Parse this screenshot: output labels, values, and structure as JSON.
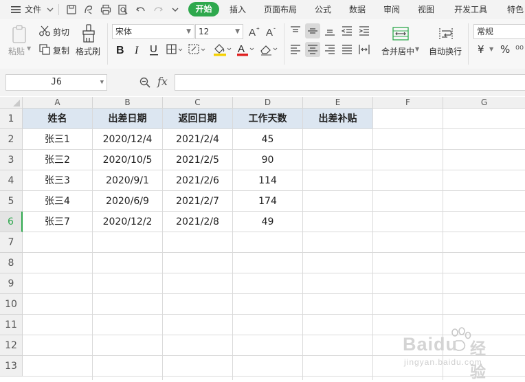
{
  "menu": {
    "file_label": "文件",
    "tabs": [
      {
        "label": "开始",
        "active": true
      },
      {
        "label": "插入"
      },
      {
        "label": "页面布局"
      },
      {
        "label": "公式"
      },
      {
        "label": "数据"
      },
      {
        "label": "审阅"
      },
      {
        "label": "视图"
      },
      {
        "label": "开发工具"
      },
      {
        "label": "特色"
      }
    ]
  },
  "ribbon": {
    "paste": "粘贴",
    "cut": "剪切",
    "copy": "复制",
    "format_painter": "格式刷",
    "font_name": "宋体",
    "font_size": "12",
    "merge_center": "合并居中",
    "wrap_text": "自动换行",
    "number_format": "常规",
    "currency_symbol": "¥",
    "percent_symbol": "%"
  },
  "formula_bar": {
    "name_box": "J6",
    "fx": "fx",
    "formula": ""
  },
  "sheet": {
    "columns": [
      "A",
      "B",
      "C",
      "D",
      "E",
      "F",
      "G"
    ],
    "rows": [
      "1",
      "2",
      "3",
      "4",
      "5",
      "6",
      "7",
      "8",
      "9",
      "10",
      "11",
      "12",
      "13"
    ],
    "active_row": "6",
    "header": [
      "姓名",
      "出差日期",
      "返回日期",
      "工作天数",
      "出差补贴"
    ],
    "data": [
      [
        "张三1",
        "2020/12/4",
        "2021/2/4",
        "45",
        ""
      ],
      [
        "张三2",
        "2020/10/5",
        "2021/2/5",
        "90",
        ""
      ],
      [
        "张三3",
        "2020/9/1",
        "2021/2/6",
        "114",
        ""
      ],
      [
        "张三4",
        "2020/6/9",
        "2021/2/7",
        "174",
        ""
      ],
      [
        "张三7",
        "2020/12/2",
        "2021/2/8",
        "49",
        ""
      ]
    ]
  },
  "watermark": {
    "brand": "Baidu",
    "brand_cn": "经验",
    "url": "jingyan.baidu.com"
  },
  "colors": {
    "accent": "#2ea84d",
    "header_fill": "#dce6f1",
    "font_color_bar": "#e02020",
    "highlight_bar": "#f5d000"
  }
}
